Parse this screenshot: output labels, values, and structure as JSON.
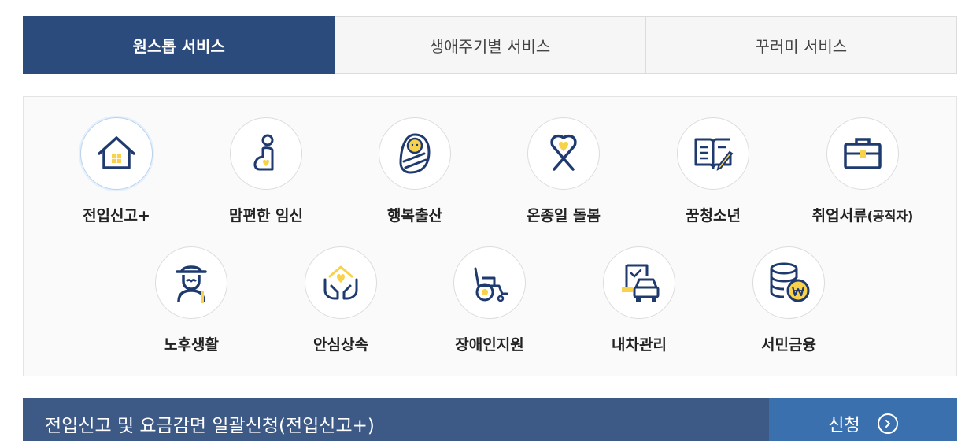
{
  "tabs": [
    {
      "label": "원스톱 서비스",
      "active": true
    },
    {
      "label": "생애주기별 서비스",
      "active": false
    },
    {
      "label": "꾸러미 서비스",
      "active": false
    }
  ],
  "services_row1": [
    {
      "label": "전입신고+",
      "icon": "house-icon"
    },
    {
      "label": "맘편한 임신",
      "icon": "pregnant-icon"
    },
    {
      "label": "행복출산",
      "icon": "baby-icon"
    },
    {
      "label": "온종일 돌봄",
      "icon": "ribbon-heart-icon"
    },
    {
      "label": "꿈청소년",
      "icon": "book-pencil-icon"
    },
    {
      "label": "취업서류",
      "label_small": "(공직자)",
      "icon": "briefcase-icon"
    }
  ],
  "services_row2": [
    {
      "label": "노후생활",
      "icon": "elderly-icon"
    },
    {
      "label": "안심상속",
      "icon": "hands-house-icon"
    },
    {
      "label": "장애인지원",
      "icon": "wheelchair-icon"
    },
    {
      "label": "내차관리",
      "icon": "car-document-icon"
    },
    {
      "label": "서민금융",
      "icon": "coins-won-icon"
    }
  ],
  "bottom": {
    "title": "전입신고 및 요금감면 일괄신청(전입신고+)",
    "button_label": "신청",
    "button_icon": "chevron-right-circle-icon"
  },
  "colors": {
    "navy": "#2b4b7d",
    "icon_navy": "#1f3a6e",
    "accent_yellow": "#f7d24a",
    "button_blue": "#3a70ae"
  }
}
